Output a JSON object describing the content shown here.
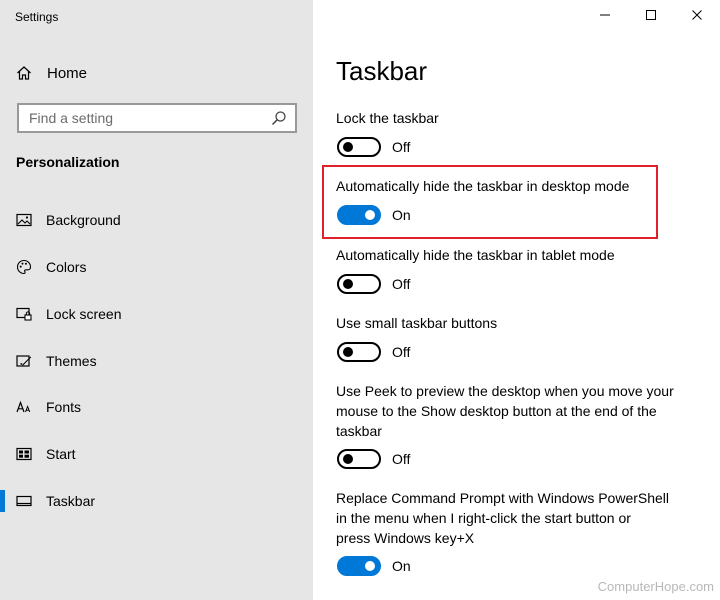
{
  "window": {
    "title": "Settings",
    "controls": [
      "minimize-icon",
      "maximize-icon",
      "close-icon"
    ]
  },
  "sidebar": {
    "home_label": "Home",
    "search": {
      "placeholder": "Find a setting",
      "icon": "search-icon"
    },
    "section_title": "Personalization",
    "items": [
      {
        "label": "Background",
        "icon": "picture-icon",
        "selected": false
      },
      {
        "label": "Colors",
        "icon": "palette-icon",
        "selected": false
      },
      {
        "label": "Lock screen",
        "icon": "lock-screen-icon",
        "selected": false
      },
      {
        "label": "Themes",
        "icon": "themes-icon",
        "selected": false
      },
      {
        "label": "Fonts",
        "icon": "fonts-icon",
        "selected": false
      },
      {
        "label": "Start",
        "icon": "start-icon",
        "selected": false
      },
      {
        "label": "Taskbar",
        "icon": "taskbar-icon",
        "selected": true
      }
    ]
  },
  "main": {
    "title": "Taskbar",
    "settings": [
      {
        "label": "Lock the taskbar",
        "state": "Off",
        "on": false
      },
      {
        "label": "Automatically hide the taskbar in desktop mode",
        "state": "On",
        "on": true
      },
      {
        "label": "Automatically hide the taskbar in tablet mode",
        "state": "Off",
        "on": false
      },
      {
        "label": "Use small taskbar buttons",
        "state": "Off",
        "on": false
      },
      {
        "label_lines": [
          "Use Peek to preview the desktop when you move your",
          "mouse to the Show desktop button at the end of the",
          "taskbar"
        ],
        "state": "Off",
        "on": false
      },
      {
        "label_lines": [
          "Replace Command Prompt with Windows PowerShell",
          "in the menu when I right-click the start button or",
          "press Windows key+X"
        ],
        "state": "On",
        "on": true
      }
    ]
  },
  "colors": {
    "accent": "#0078d7",
    "highlight_border": "#e0202a",
    "sidebar_bg": "#e6e6e6"
  },
  "watermark": "ComputerHope.com"
}
